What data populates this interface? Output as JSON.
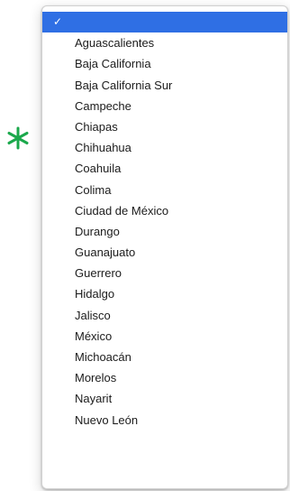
{
  "colors": {
    "selection": "#2f6fe4",
    "required_marker": "#1aa84b",
    "text": "#1b1b1b"
  },
  "required_marker": {
    "icon": "asterisk-icon",
    "symbol": "✱"
  },
  "dropdown": {
    "selected_index": 0,
    "options": [
      {
        "label": "",
        "checked": true
      },
      {
        "label": "Aguascalientes"
      },
      {
        "label": "Baja California"
      },
      {
        "label": "Baja California Sur"
      },
      {
        "label": "Campeche"
      },
      {
        "label": "Chiapas"
      },
      {
        "label": "Chihuahua"
      },
      {
        "label": "Coahuila"
      },
      {
        "label": "Colima"
      },
      {
        "label": "Ciudad de México"
      },
      {
        "label": "Durango"
      },
      {
        "label": "Guanajuato"
      },
      {
        "label": "Guerrero"
      },
      {
        "label": "Hidalgo"
      },
      {
        "label": "Jalisco"
      },
      {
        "label": "México"
      },
      {
        "label": "Michoacán"
      },
      {
        "label": "Morelos"
      },
      {
        "label": "Nayarit"
      },
      {
        "label": "Nuevo León"
      }
    ]
  }
}
